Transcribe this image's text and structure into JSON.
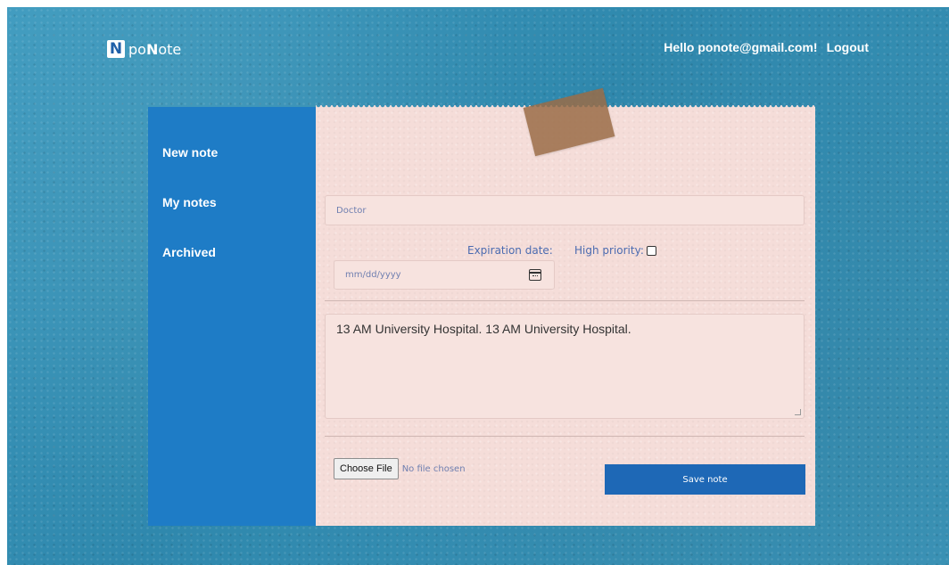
{
  "brand": {
    "mark": "N",
    "name_prefix": "po",
    "name_bold": "N",
    "name_suffix": "ote"
  },
  "header": {
    "greeting": "Hello ponote@gmail.com!",
    "logout_label": "Logout"
  },
  "sidebar": {
    "items": [
      {
        "label": "New note"
      },
      {
        "label": "My notes"
      },
      {
        "label": "Archived"
      }
    ]
  },
  "form": {
    "title_value": "Doctor",
    "expiration_label": "Expiration date:",
    "priority_label": "High priority:",
    "priority_checked": false,
    "date_placeholder": "mm/dd/yyyy",
    "body_value": "13 AM University Hospital. 13 AM University Hospital.",
    "file_button_label": "Choose File",
    "file_status": "No file chosen",
    "save_label": "Save note"
  },
  "colors": {
    "background": "#3393b8",
    "sidebar": "#1e7cc6",
    "paper": "#f5ddd9",
    "button": "#1e68b6",
    "label": "#4b6bb0"
  },
  "icons": {
    "calendar": "calendar-icon"
  }
}
